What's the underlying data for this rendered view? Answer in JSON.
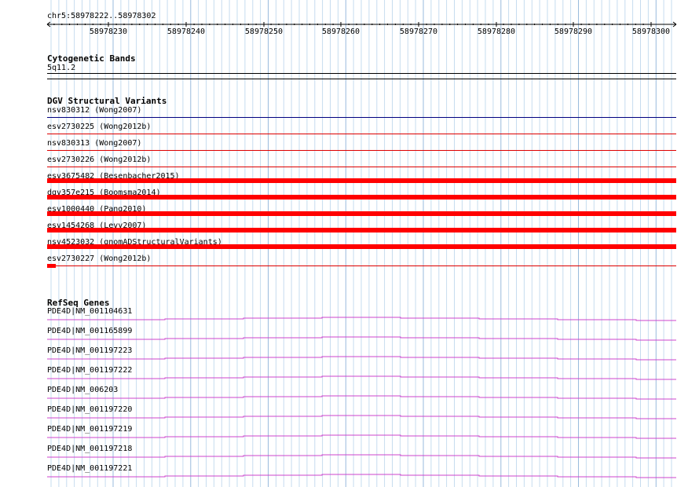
{
  "region_label": "chr5:58978222..58978302",
  "ruler": {
    "ticks": [
      "58978230",
      "58978240",
      "58978250",
      "58978260",
      "58978270",
      "58978280",
      "58978290",
      "58978300"
    ]
  },
  "tracks": {
    "cytogenetic": {
      "title": "Cytogenetic Bands",
      "band": "5q11.2"
    },
    "dgv": {
      "title": "DGV Structural Variants",
      "items": [
        {
          "label": "nsv830312 (Wong2007)",
          "color": "#00007f",
          "type": "line"
        },
        {
          "label": "esv2730225 (Wong2012b)",
          "color": "#dd0000",
          "type": "line"
        },
        {
          "label": "nsv830313 (Wong2007)",
          "color": "#dd0000",
          "type": "line"
        },
        {
          "label": "esv2730226 (Wong2012b)",
          "color": "#dd0000",
          "type": "line"
        },
        {
          "label": "esv3675482 (Besenbacher2015)",
          "color": "#ff0000",
          "type": "bar"
        },
        {
          "label": "dgv357e215 (Boomsma2014)",
          "color": "#ff0000",
          "type": "bar"
        },
        {
          "label": "esv1000440 (Pang2010)",
          "color": "#ff0000",
          "type": "bar"
        },
        {
          "label": "esv1454268 (Levy2007)",
          "color": "#ff0000",
          "type": "bar"
        },
        {
          "label": "nsv4523032 (gnomADStructuralVariants)",
          "color": "#ff0000",
          "type": "bar"
        },
        {
          "label": "esv2730227 (Wong2012b)",
          "color": "#dd0000",
          "type": "line"
        }
      ]
    },
    "refseq": {
      "title": "RefSeq Genes",
      "color": "#cc44cc",
      "items": [
        "PDE4D|NM_001104631",
        "PDE4D|NM_001165899",
        "PDE4D|NM_001197223",
        "PDE4D|NM_001197222",
        "PDE4D|NM_006203",
        "PDE4D|NM_001197220",
        "PDE4D|NM_001197219",
        "PDE4D|NM_001197218",
        "PDE4D|NM_001197221"
      ]
    }
  }
}
